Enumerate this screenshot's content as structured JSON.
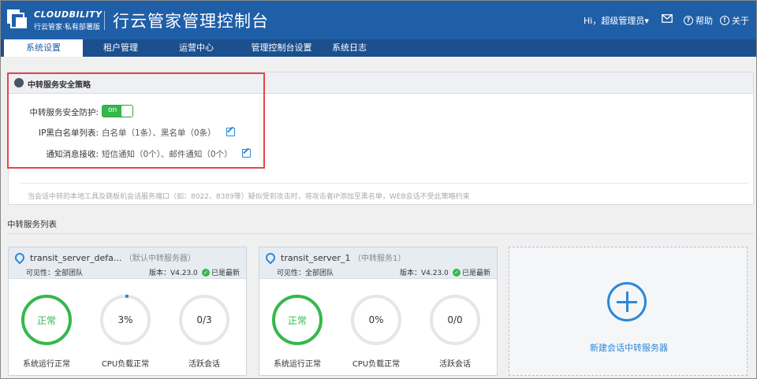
{
  "header": {
    "logo_en": "CLOUDBILITY",
    "logo_cn": "行云管家·私有部署版",
    "title": "行云管家管理控制台",
    "user_greeting": "Hi，超级管理员",
    "help_label": "帮助",
    "about_label": "关于"
  },
  "nav": {
    "items": [
      "系统设置",
      "租户管理",
      "运营中心",
      "管理控制台设置",
      "系统日志"
    ],
    "active": "系统设置"
  },
  "policy": {
    "title": "中转服务安全策略",
    "protection_label": "中转服务安全防护:",
    "protection_state": "on",
    "ip_list_label": "IP黑白名单列表:",
    "ip_list_value": "白名单（1条）、黑名单（0条）",
    "notify_label": "通知消息接收:",
    "notify_value": "短信通知（0个）、邮件通知（0个）",
    "note": "当会话中转的本地工具及跳板机会话服务端口（如：8022、8389等）疑似受到攻击时，将攻击者IP添加至黑名单，WEB会话不受此策略约束"
  },
  "server_list_title": "中转服务列表",
  "servers": [
    {
      "name": "transit_server_defa...",
      "subtitle": "（默认中转服务器）",
      "visibility": "可见性：全部团队",
      "version": "版本：V4.23.0",
      "status": "已是最新",
      "metrics": [
        {
          "value": "正常",
          "caption": "系统运行正常"
        },
        {
          "value": "3%",
          "caption": "CPU负载正常"
        },
        {
          "value": "0/3",
          "caption": "活跃会话"
        }
      ]
    },
    {
      "name": "transit_server_1",
      "subtitle": "（中转服务1）",
      "visibility": "可见性：全部团队",
      "version": "版本：V4.23.0",
      "status": "已是最新",
      "metrics": [
        {
          "value": "正常",
          "caption": "系统运行正常"
        },
        {
          "value": "0%",
          "caption": "CPU负载正常"
        },
        {
          "value": "0/0",
          "caption": "活跃会话"
        }
      ]
    }
  ],
  "new_server_label": "新建会话中转服务器",
  "colors": {
    "header_bg": "#1f5fa8",
    "nav_bg": "#1b4f8e",
    "accent": "#2a88d8",
    "ok_green": "#35b84b",
    "highlight_red": "#e5454b"
  }
}
